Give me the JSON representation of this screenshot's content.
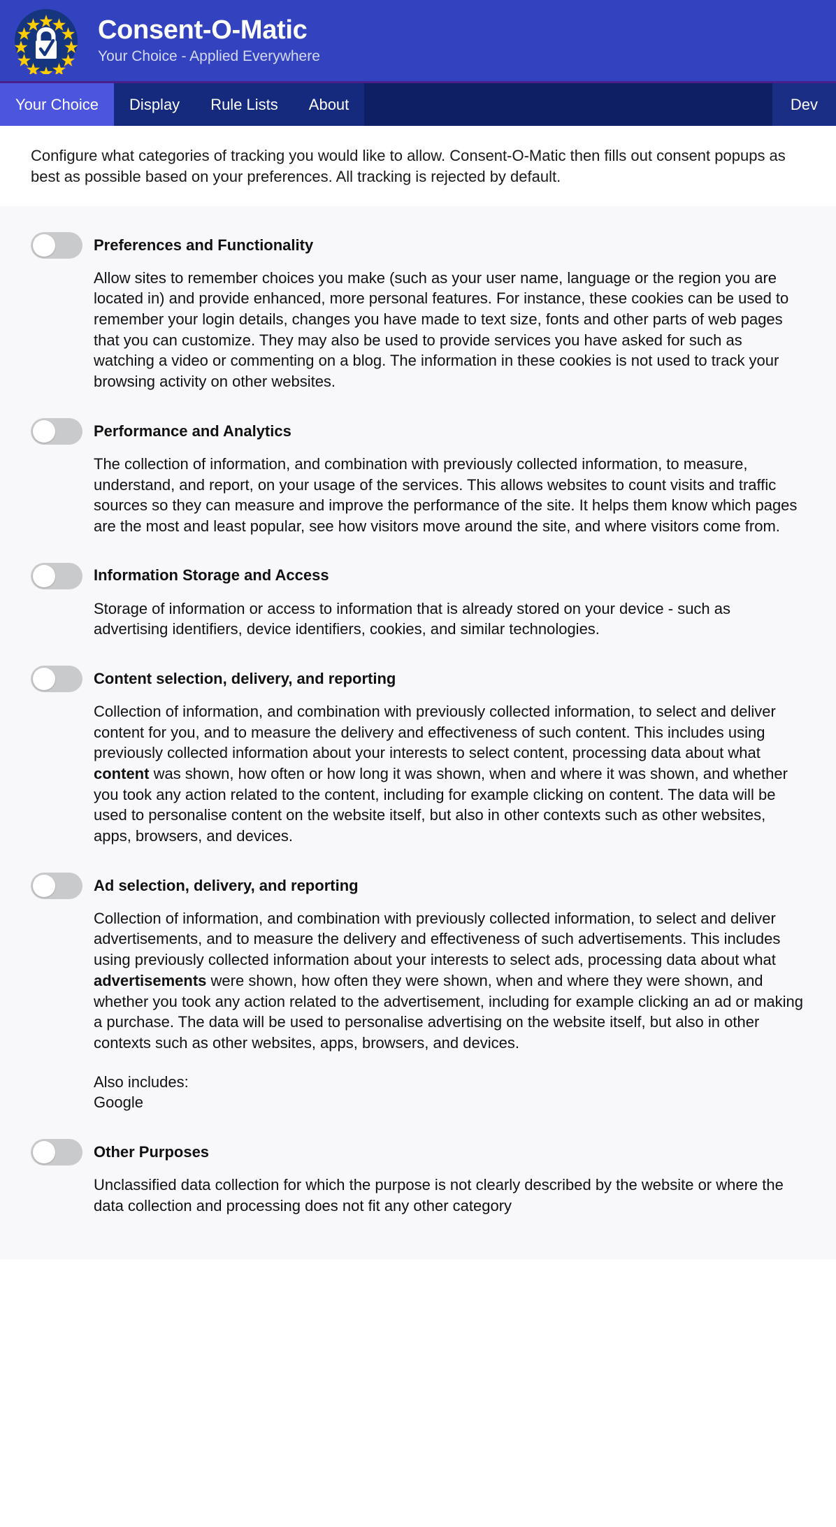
{
  "header": {
    "title": "Consent-O-Matic",
    "tagline": "Your Choice - Applied Everywhere",
    "logo_icon": "eu-padlock-check-icon",
    "bg_color": "#3343C0"
  },
  "nav": {
    "bg_color": "#152A7D",
    "active_color": "#4B55DD",
    "items": [
      {
        "label": "Your Choice",
        "active": true
      },
      {
        "label": "Display",
        "active": false
      },
      {
        "label": "Rule Lists",
        "active": false
      },
      {
        "label": "About",
        "active": false
      }
    ],
    "right_items": [
      {
        "label": "Dev",
        "active": false
      }
    ]
  },
  "intro": {
    "text": "Configure what categories of tracking you would like to allow. Consent-O-Matic then fills out consent popups as best as possible based on your preferences. All tracking is rejected by default."
  },
  "categories": [
    {
      "title": "Preferences and Functionality",
      "enabled": false,
      "description": "Allow sites to remember choices you make (such as your user name, language or the region you are located in) and provide enhanced, more personal features. For instance, these cookies can be used to remember your login details, changes you have made to text size, fonts and other parts of web pages that you can customize. They may also be used to provide services you have asked for such as watching a video or commenting on a blog. The information in these cookies is not used to track your browsing activity on other websites."
    },
    {
      "title": "Performance and Analytics",
      "enabled": false,
      "description": "The collection of information, and combination with previously collected information, to measure, understand, and report, on your usage of the services. This allows websites to count visits and traffic sources so they can measure and improve the performance of the site. It helps them know which pages are the most and least popular, see how visitors move around the site, and where visitors come from."
    },
    {
      "title": "Information Storage and Access",
      "enabled": false,
      "description": "Storage of information or access to information that is already stored on your device - such as advertising identifiers, device identifiers, cookies, and similar technologies."
    },
    {
      "title": "Content selection, delivery, and reporting",
      "enabled": false,
      "description_part1": "Collection of information, and combination with previously collected information, to select and deliver content for you, and to measure the delivery and effectiveness of such content. This includes using previously collected information about your interests to select content, processing data about what ",
      "description_bold": "content",
      "description_part2": " was shown, how often or how long it was shown, when and where it was shown, and whether you took any action related to the content, including for example clicking on content. The data will be used to personalise content on the website itself, but also in other contexts such as other websites, apps, browsers, and devices."
    },
    {
      "title": "Ad selection, delivery, and reporting",
      "enabled": false,
      "description_part1": "Collection of information, and combination with previously collected information, to select and deliver advertisements, and to measure the delivery and effectiveness of such advertisements. This includes using previously collected information about your interests to select ads, processing data about what ",
      "description_bold": "advertisements",
      "description_part2": " were shown, how often they were shown, when and where they were shown, and whether you took any action related to the advertisement, including for example clicking an ad or making a purchase. The data will be used to personalise advertising on the website itself, but also in other contexts such as other websites, apps, browsers, and devices.",
      "also_includes_label": "Also includes:",
      "also_includes_value": "Google"
    },
    {
      "title": "Other Purposes",
      "enabled": false,
      "description": "Unclassified data collection for which the purpose is not clearly described by the website or where the data collection and processing does not fit any other category"
    }
  ]
}
